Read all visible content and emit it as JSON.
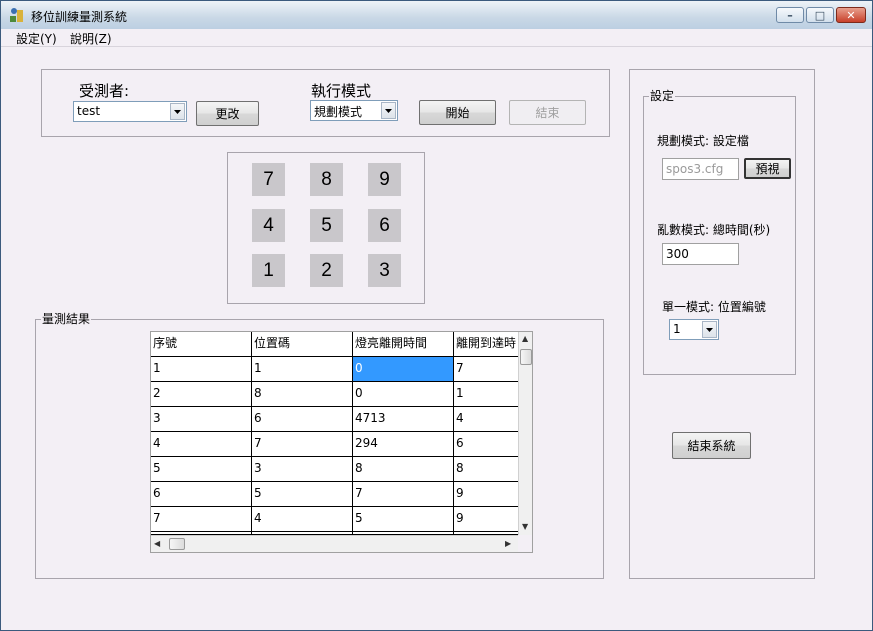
{
  "window": {
    "title": "移位訓練量測系統",
    "controls": {
      "minimize": "–",
      "maximize": "□",
      "close": "✕"
    }
  },
  "menu": [
    "設定(Y)",
    "說明(Z)"
  ],
  "subject": {
    "label": "受測者:",
    "value": "test",
    "change_button": "更改"
  },
  "mode": {
    "label": "執行模式",
    "value": "規劃模式",
    "start_button": "開始",
    "end_button": "結束"
  },
  "keypad": [
    "7",
    "8",
    "9",
    "4",
    "5",
    "6",
    "1",
    "2",
    "3"
  ],
  "results": {
    "label": "量測結果",
    "columns": [
      "序號",
      "位置碼",
      "燈亮離開時間",
      "離開到達時"
    ],
    "rows": [
      [
        "1",
        "1",
        "0",
        "7"
      ],
      [
        "2",
        "8",
        "0",
        "1"
      ],
      [
        "3",
        "6",
        "4713",
        "4"
      ],
      [
        "4",
        "7",
        "294",
        "6"
      ],
      [
        "5",
        "3",
        "8",
        "8"
      ],
      [
        "6",
        "5",
        "7",
        "9"
      ],
      [
        "7",
        "4",
        "5",
        "9"
      ]
    ],
    "selected_cell": {
      "row": 0,
      "col": 2
    }
  },
  "settings": {
    "label": "設定",
    "plan_mode_label": "規劃模式: 設定檔",
    "plan_file": "spos3.cfg",
    "preview_button": "預視",
    "random_mode_label": "亂數模式: 總時間(秒)",
    "random_total_time": "300",
    "single_mode_label": "單一模式: 位置編號",
    "single_position": "1"
  },
  "exit_button": "結束系統",
  "colors": {
    "selection": "#3399ff",
    "titlebar": "#c9d8e6",
    "close": "#c8402a"
  }
}
